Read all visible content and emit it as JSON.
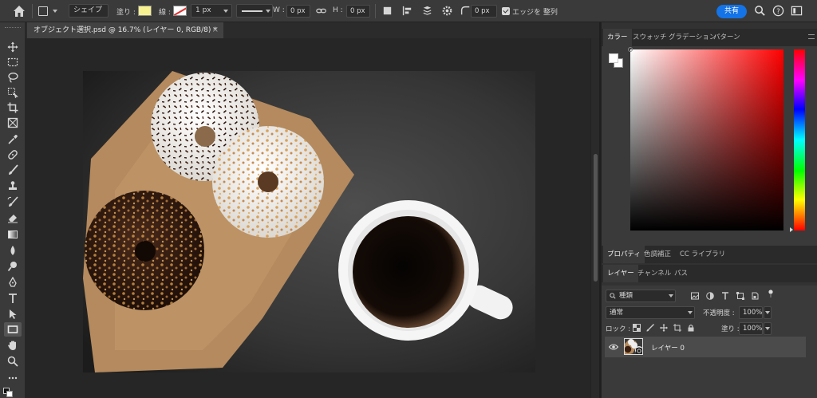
{
  "options_bar": {
    "shape_mode_label": "シェイプ",
    "fill_label": "塗り :",
    "stroke_label": "線 :",
    "stroke_width": "1 px",
    "w_label": "W :",
    "w_value": "0 px",
    "h_label": "H :",
    "h_value": "0 px",
    "corner_radius": "0 px",
    "align_edges_label": "エッジを 整列",
    "share_label": "共有",
    "fill_color": "#f7f28f"
  },
  "document": {
    "tab_title": "オブジェクト選択.psd @ 16.7% (レイヤー 0, RGB/8) *",
    "close_glyph": "×"
  },
  "color_panel": {
    "tabs": [
      "カラー",
      "スウォッチ",
      "グラデーション",
      "パターン"
    ],
    "active_tab": 0,
    "hue_color": "#ff0000"
  },
  "properties_panel": {
    "tabs": [
      "プロパティ",
      "色調補正",
      "CC ライブラリ"
    ],
    "active_tab": 0
  },
  "layers_panel": {
    "tabs": [
      "レイヤー",
      "チャンネル",
      "パス"
    ],
    "active_tab": 0,
    "filter_kind": "種類",
    "blend_mode": "通常",
    "opacity_label": "不透明度 :",
    "opacity_value": "100%",
    "lock_label": "ロック :",
    "fill_label": "塗り :",
    "fill_value": "100%",
    "layers": [
      {
        "name": "レイヤー 0",
        "visible": true,
        "selected": true
      }
    ]
  }
}
